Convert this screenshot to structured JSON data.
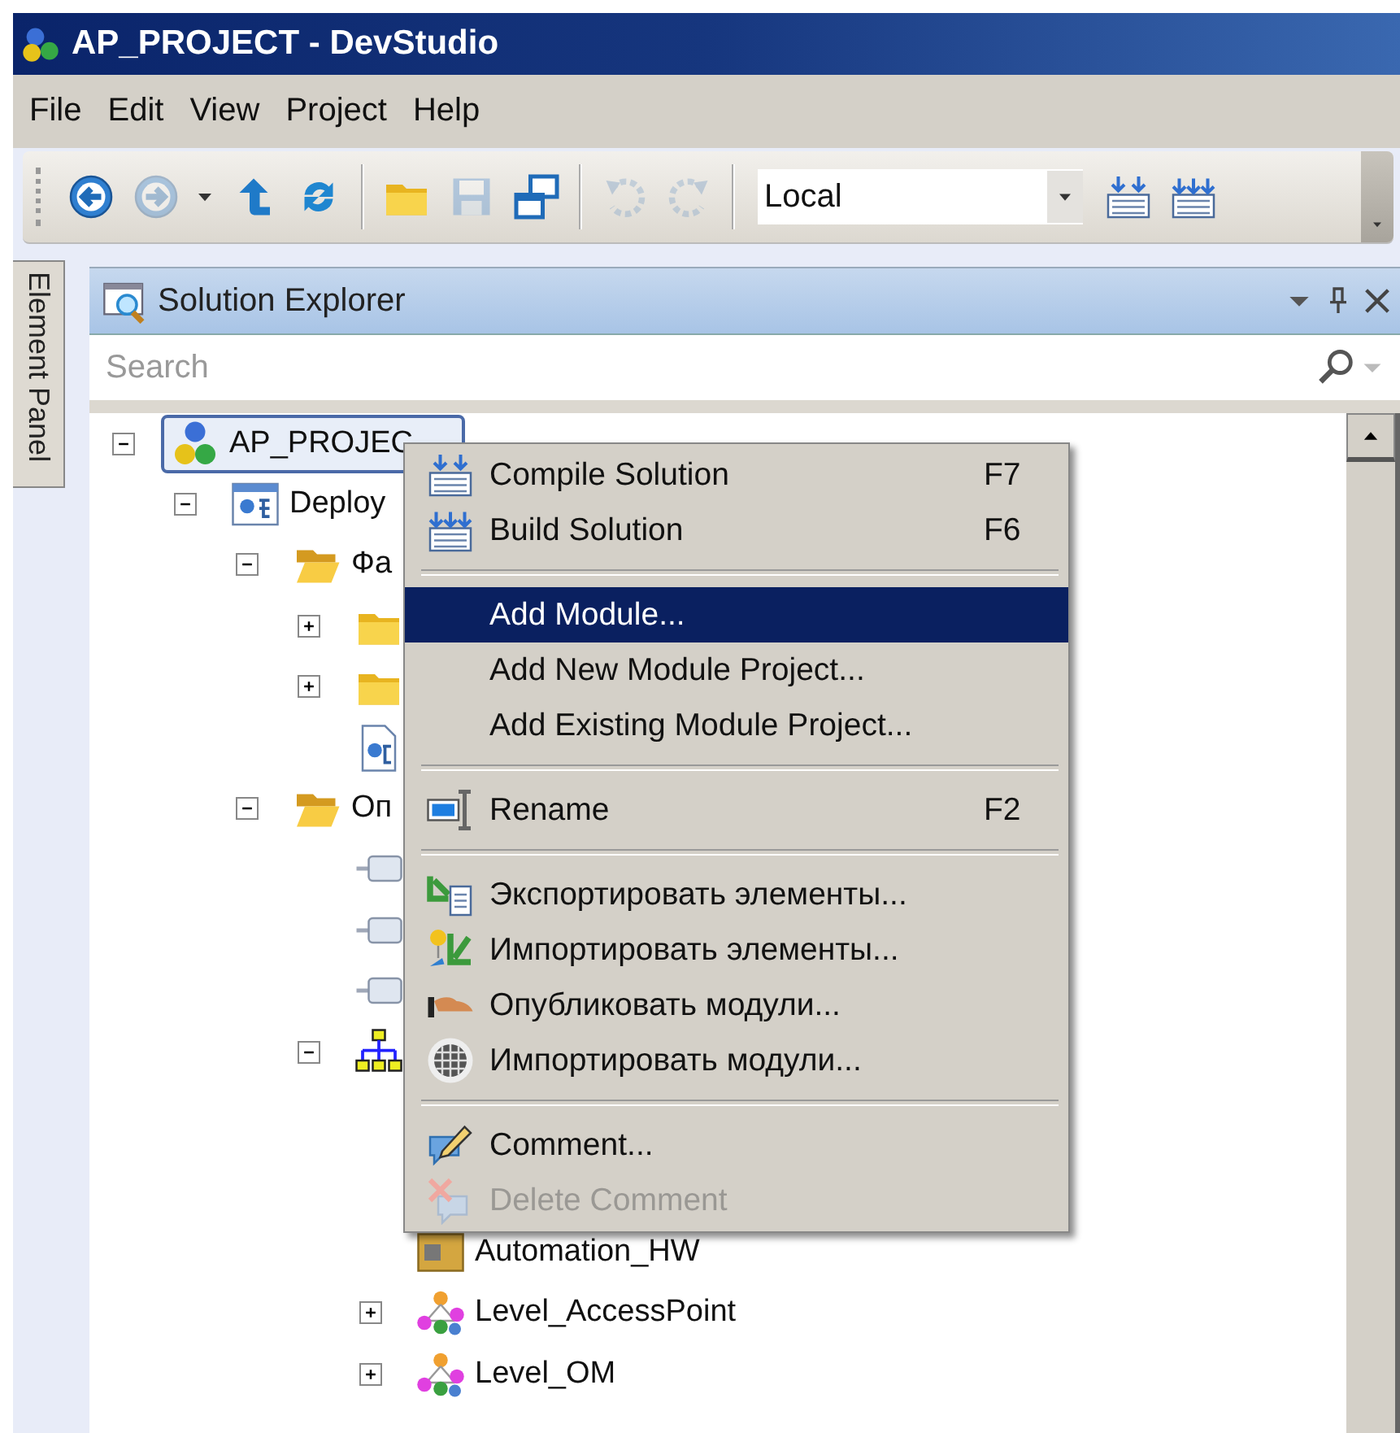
{
  "window": {
    "title": "AP_PROJECT - DevStudio"
  },
  "menu_bar": [
    "File",
    "Edit",
    "View",
    "Project",
    "Help"
  ],
  "toolbar": [
    {
      "kind": "button",
      "disabled": false
    },
    {
      "kind": "button",
      "disabled": true
    },
    {
      "kind": "dropdown",
      "disabled": false
    },
    {
      "kind": "button",
      "disabled": false
    },
    {
      "kind": "button",
      "disabled": false
    },
    {
      "kind": "separator"
    },
    {
      "kind": "button",
      "disabled": false
    },
    {
      "kind": "button",
      "disabled": true
    },
    {
      "kind": "button",
      "disabled": false
    },
    {
      "kind": "separator"
    },
    {
      "kind": "button",
      "disabled": true
    },
    {
      "kind": "button",
      "disabled": true
    },
    {
      "kind": "separator"
    },
    {
      "kind": "combo",
      "value": "Local"
    },
    {
      "kind": "button",
      "disabled": false
    },
    {
      "kind": "button",
      "disabled": false
    }
  ],
  "side_tab": {
    "label": "Element Panel"
  },
  "solution_explorer": {
    "title": "Solution Explorer",
    "search": {
      "placeholder": "Search"
    },
    "tree": [
      {
        "label": "AP_PROJEC",
        "kind": "project",
        "expanded": true,
        "selected": true,
        "children": [
          {
            "label": "Deploy",
            "kind": "deployment",
            "expanded": true,
            "selected": false,
            "children": [
              {
                "label": "Фа",
                "kind": "openfolder",
                "expanded": true,
                "selected": false,
                "children": [
                  {
                    "kind": "folder",
                    "expanded": false,
                    "selected": false
                  },
                  {
                    "kind": "folder",
                    "expanded": false,
                    "selected": false
                  },
                  {
                    "kind": "document",
                    "selected": false
                  }
                ]
              },
              {
                "label": "Оп",
                "kind": "openfolder",
                "expanded": true,
                "selected": false,
                "children": [
                  {
                    "kind": "connector",
                    "selected": false
                  },
                  {
                    "kind": "connector",
                    "selected": false
                  },
                  {
                    "kind": "connector",
                    "selected": false
                  },
                  {
                    "kind": "network",
                    "expanded": true,
                    "selected": false,
                    "children": [
                      {
                        "label": "Automation_HW",
                        "kind": "hardware",
                        "selected": false
                      },
                      {
                        "label": "Level_AccessPoint",
                        "kind": "level",
                        "expanded": false,
                        "selected": false
                      },
                      {
                        "label": "Level_OM",
                        "kind": "level",
                        "expanded": false,
                        "selected": false
                      }
                    ]
                  }
                ]
              }
            ]
          }
        ]
      }
    ]
  },
  "context_menu": [
    {
      "kind": "item",
      "label": "Compile Solution",
      "shortcut": "F7",
      "selected": false,
      "disabled": false
    },
    {
      "kind": "item",
      "label": "Build Solution",
      "shortcut": "F6",
      "selected": false,
      "disabled": false
    },
    {
      "kind": "separator"
    },
    {
      "kind": "item",
      "label": "Add Module...",
      "selected": true,
      "disabled": false
    },
    {
      "kind": "item",
      "label": "Add New Module Project...",
      "selected": false,
      "disabled": false
    },
    {
      "kind": "item",
      "label": "Add Existing Module Project...",
      "selected": false,
      "disabled": false
    },
    {
      "kind": "separator"
    },
    {
      "kind": "item",
      "label": "Rename",
      "shortcut": "F2",
      "selected": false,
      "disabled": false
    },
    {
      "kind": "separator"
    },
    {
      "kind": "item",
      "label": "Экспортировать элементы...",
      "selected": false,
      "disabled": false
    },
    {
      "kind": "item",
      "label": "Импортировать элементы...",
      "selected": false,
      "disabled": false
    },
    {
      "kind": "item",
      "label": "Опубликовать модули...",
      "selected": false,
      "disabled": false
    },
    {
      "kind": "item",
      "label": "Импортировать модули...",
      "selected": false,
      "disabled": false
    },
    {
      "kind": "separator"
    },
    {
      "kind": "item",
      "label": "Comment...",
      "selected": false,
      "disabled": false
    },
    {
      "kind": "item",
      "label": "Delete Comment",
      "selected": false,
      "disabled": true
    }
  ]
}
